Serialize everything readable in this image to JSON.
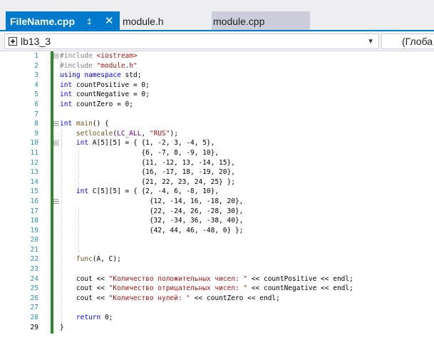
{
  "tabs": [
    {
      "label": "FileName.cpp",
      "active": true
    },
    {
      "label": "module.h",
      "active": false
    },
    {
      "label": "module.cpp",
      "active": false
    }
  ],
  "tab_pin_glyph": "‡",
  "tab_close_glyph": "✕",
  "navbar": {
    "scope": "lb13_3",
    "dropdown_glyph": "▼",
    "member_scope": "(Глоба"
  },
  "editor": {
    "current_line": 29,
    "lines": [
      {
        "n": "1",
        "text": "#include <iostream>"
      },
      {
        "n": "2",
        "text": "#include \"module.h\""
      },
      {
        "n": "3",
        "text": "using namespace std;"
      },
      {
        "n": "4",
        "text": "int countPositive = 0;"
      },
      {
        "n": "5",
        "text": "int countNegative = 0;"
      },
      {
        "n": "6",
        "text": "int countZero = 0;"
      },
      {
        "n": "7",
        "text": ""
      },
      {
        "n": "8",
        "text": "int main() {"
      },
      {
        "n": "9",
        "text": "    setlocale(LC_ALL, \"RUS\");"
      },
      {
        "n": "10",
        "text": "    int A[5][5] = { {1, -2, 3, -4, 5},"
      },
      {
        "n": "11",
        "text": "                    {6, -7, 8, -9, 10},"
      },
      {
        "n": "12",
        "text": "                    {11, -12, 13, -14, 15},"
      },
      {
        "n": "13",
        "text": "                    {16, -17, 18, -19, 20},"
      },
      {
        "n": "14",
        "text": "                    {21, 22, 23, 24, 25} };"
      },
      {
        "n": "15",
        "text": "    int C[5][5] = { {2, -4, 6, -8, 10},"
      },
      {
        "n": "16",
        "text": "                      {12, -14, 16, -18, 20},"
      },
      {
        "n": "17",
        "text": "                      {22, -24, 26, -28, 30},"
      },
      {
        "n": "18",
        "text": "                      {32, -34, 36, -38, 40},"
      },
      {
        "n": "19",
        "text": "                      {42, 44, 46, -48, 0} };"
      },
      {
        "n": "20",
        "text": ""
      },
      {
        "n": "21",
        "text": ""
      },
      {
        "n": "22",
        "text": "    func(A, C);"
      },
      {
        "n": "23",
        "text": ""
      },
      {
        "n": "24",
        "text": "    cout << \"Количество положительных чисел: \" << countPositive << endl;"
      },
      {
        "n": "25",
        "text": "    cout << \"Количество отрицательных чисел: \" << countNegative << endl;"
      },
      {
        "n": "26",
        "text": "    cout << \"Количество нулей: \" << countZero << endl;"
      },
      {
        "n": "27",
        "text": ""
      },
      {
        "n": "28",
        "text": "    return 0;"
      },
      {
        "n": "29",
        "text": "}"
      }
    ]
  },
  "colors": {
    "accent": "#007acc",
    "keyword": "#0000ff",
    "preprocessor": "#808080",
    "string": "#a31515",
    "macro": "#6f008a",
    "function": "#74531f",
    "line_number": "#2b91af",
    "change_bar": "#2e8b2e"
  }
}
